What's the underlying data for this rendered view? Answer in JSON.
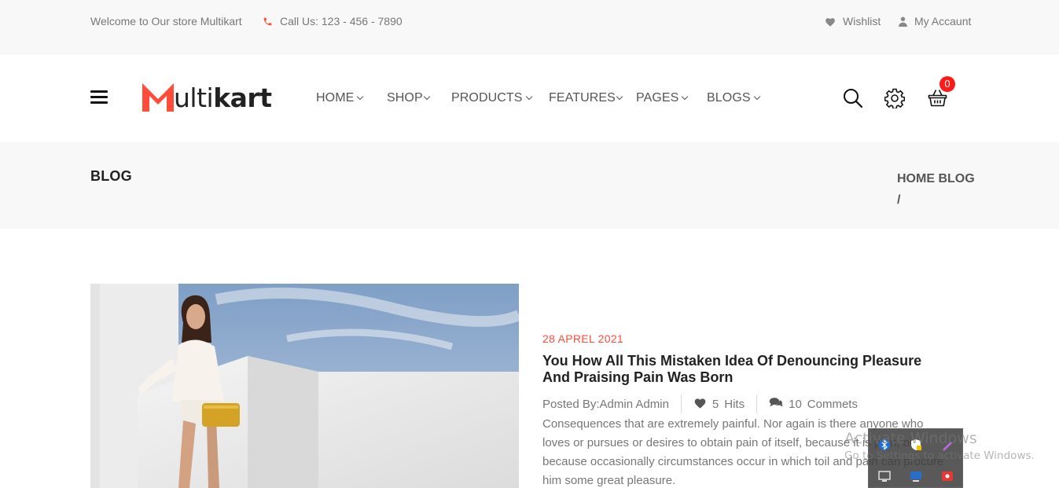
{
  "topbar": {
    "welcome": "Welcome to Our store Multikart",
    "call": "Call Us: 123 - 456 - 7890",
    "wishlist": "Wishlist",
    "account": "My Accaunt"
  },
  "header": {
    "logo_text": "Multikart",
    "nav": [
      "HOME",
      "SHOP",
      "PRODUCTS",
      "FEATURES",
      "PAGES",
      "BLOGS"
    ],
    "cart_count": "0",
    "icons": [
      "menu-icon",
      "search-icon",
      "gear-icon",
      "basket-icon"
    ]
  },
  "breadcrumb": {
    "title": "BLOG",
    "trail": "HOME BLOG",
    "separator": "/"
  },
  "post": {
    "date": "28 APREL 2021",
    "title": "You How All This Mistaken Idea Of Denouncing Pleasure And Praising Pain Was Born",
    "author": "Posted By:Admin Admin",
    "hits_count": "5",
    "hits_label": "Hits",
    "comments_count": "10",
    "comments_label": "Commets",
    "excerpt": "Consequences that are extremely painful. Nor again is there anyone who loves or pursues or desires to obtain pain of itself, because it is pain, but because occasionally circumstances occur in which toil and pain can procure him some great pleasure."
  },
  "overlay": {
    "activate_title": "Activate Windows",
    "activate_sub": "Go to Settings to activate Windows."
  },
  "colors": {
    "accent": "#ff4c3b",
    "badge": "#ff1a1a",
    "topbar_bg": "#f8f8f8",
    "text_muted": "#777777"
  }
}
